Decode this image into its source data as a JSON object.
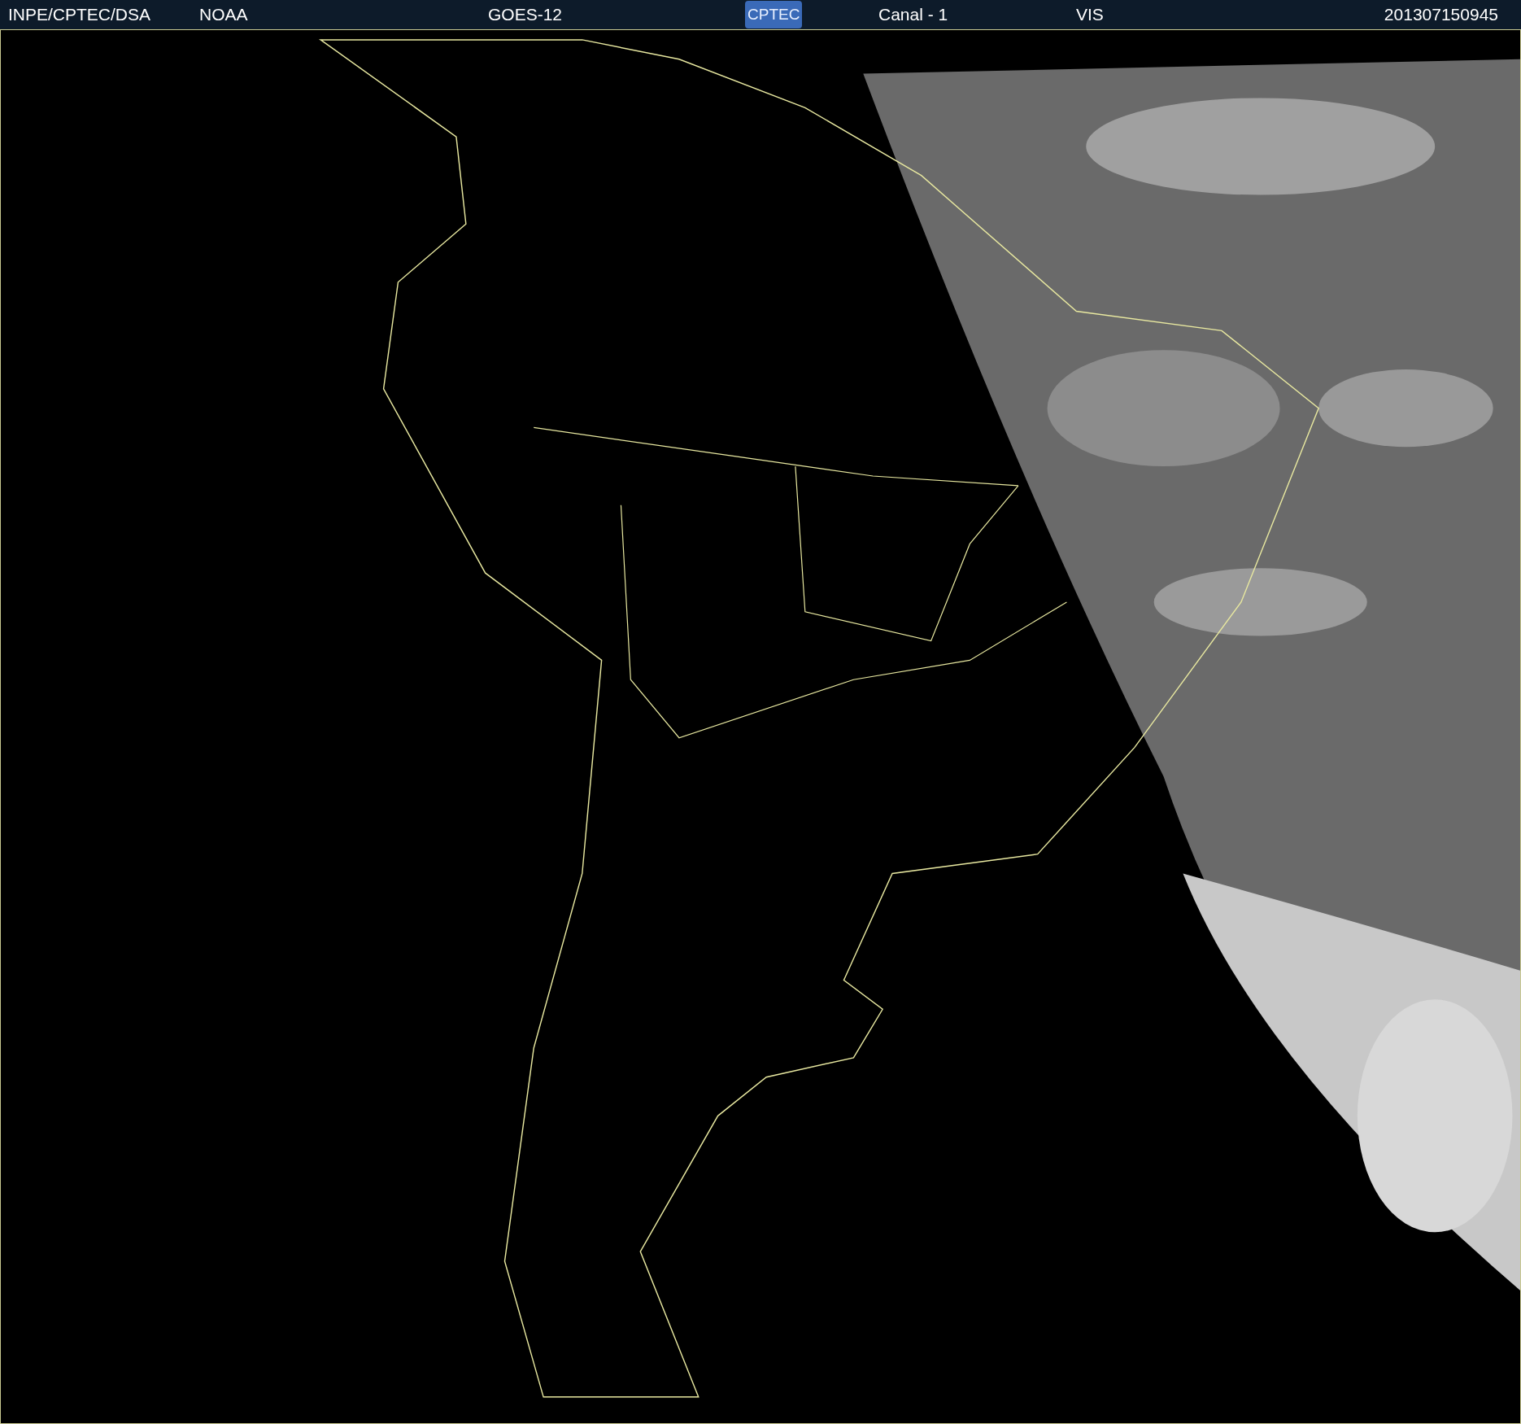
{
  "header": {
    "labels": [
      {
        "text": "INPE/CPTEC/DSA",
        "kind": "text"
      },
      {
        "text": "NOAA",
        "kind": "text"
      },
      {
        "text": "GOES-12",
        "kind": "text"
      },
      {
        "text": "CPTEC",
        "kind": "logo"
      },
      {
        "text": "Canal - 1",
        "kind": "text"
      },
      {
        "text": "VIS",
        "kind": "text"
      },
      {
        "text": "201307150945",
        "kind": "text"
      }
    ]
  }
}
